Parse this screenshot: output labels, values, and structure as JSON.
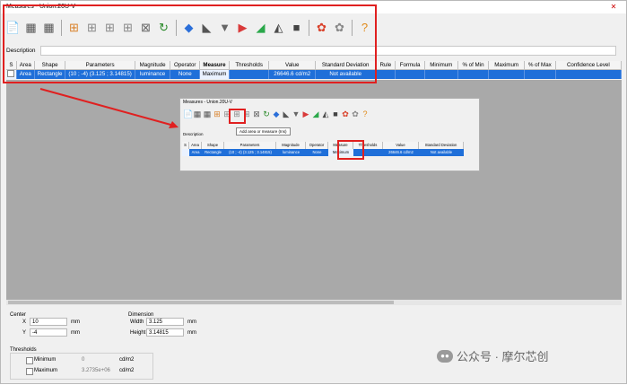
{
  "window": {
    "title": "Measures - Union.20U-V",
    "close_glyph": "✕"
  },
  "toolbar": {
    "icons": [
      {
        "name": "document-icon",
        "glyph": "📄",
        "color": "#c87a1a"
      },
      {
        "name": "grid-icon",
        "glyph": "▦",
        "color": "#555555"
      },
      {
        "name": "grid-arrow-icon",
        "glyph": "▦",
        "color": "#555555"
      },
      {
        "name": "add-area-icon",
        "glyph": "⊞",
        "color": "#d9822b"
      },
      {
        "name": "area-move-icon",
        "glyph": "⊞",
        "color": "#888888"
      },
      {
        "name": "area-move-up-icon",
        "glyph": "⊞",
        "color": "#888888"
      },
      {
        "name": "area-move-down-icon",
        "glyph": "⊞",
        "color": "#888888"
      },
      {
        "name": "area-delete-icon",
        "glyph": "⊠",
        "color": "#666666"
      },
      {
        "name": "refresh-icon",
        "glyph": "↻",
        "color": "#2a8a2a"
      },
      {
        "name": "color-diamond-icon",
        "glyph": "◆",
        "color": "#2b6fd9"
      },
      {
        "name": "ruler-icon",
        "glyph": "◣",
        "color": "#555555"
      },
      {
        "name": "filter-icon",
        "glyph": "▼",
        "color": "#666666"
      },
      {
        "name": "triangle-palette-icon",
        "glyph": "▶",
        "color": "#d93a3a"
      },
      {
        "name": "chart-3d-icon",
        "glyph": "◢",
        "color": "#2aa84a"
      },
      {
        "name": "surface-icon",
        "glyph": "◭",
        "color": "#4a4a4a"
      },
      {
        "name": "square-icon",
        "glyph": "■",
        "color": "#444444"
      },
      {
        "name": "settings-color-icon",
        "glyph": "✿",
        "color": "#d9412a"
      },
      {
        "name": "settings-gray-icon",
        "glyph": "✿",
        "color": "#888888"
      },
      {
        "name": "help-icon",
        "glyph": "?",
        "color": "#e08a1a"
      }
    ]
  },
  "description": {
    "label": "Description",
    "value": ""
  },
  "table": {
    "columns": [
      "S",
      "Area",
      "Shape",
      "Parameters",
      "Magnitude",
      "Operator",
      "Measure",
      "Thresholds",
      "Value",
      "Standard Deviation",
      "Rule",
      "Formula",
      "Minimum",
      "% of Min",
      "Maximum",
      "% of Max",
      "Confidence Level"
    ],
    "rows": [
      {
        "area": "Area",
        "shape": "Rectangle",
        "parameters": "(10 ; -4) (3.125 ; 3.14815)",
        "magnitude": "luminance",
        "operator": "None",
        "measure": "Maximum",
        "thresholds": "",
        "value": "26646.6 cd/m2",
        "std": "Not available",
        "rule": "",
        "formula": "",
        "minimum": "",
        "pct_min": "",
        "maximum": "",
        "pct_max": "",
        "confidence": ""
      }
    ]
  },
  "inset": {
    "title": "Measures - Union.20U-V",
    "tooltip": "Add area or measure (Ins)",
    "description_label": "Description",
    "columns": [
      "S",
      "Area",
      "Shape",
      "Parameters",
      "Magnitude",
      "Operator",
      "Measure",
      "Thresholds",
      "Value",
      "Standard Deviation"
    ],
    "row": {
      "area": "Area",
      "shape": "Rectangle",
      "parameters": "(10 ; -4) (3.125 ; 3.14815)",
      "magnitude": "luminance",
      "operator": "None",
      "measure": "Maximum",
      "thresholds": "",
      "value": "26646.6 cd/m2",
      "std": "Not available"
    }
  },
  "center": {
    "label": "Center",
    "x_label": "X",
    "x_value": "10",
    "x_unit": "mm",
    "y_label": "Y",
    "y_value": "-4",
    "y_unit": "mm"
  },
  "dimension": {
    "label": "Dimension",
    "width_label": "Width",
    "width_value": "3.125",
    "width_unit": "mm",
    "height_label": "Height",
    "height_value": "3.14815",
    "height_unit": "mm"
  },
  "thresholds": {
    "label": "Thresholds",
    "min_label": "Minimum",
    "min_value": "0",
    "min_unit": "cd/m2",
    "max_label": "Maximum",
    "max_value": "3.2735e+06",
    "max_unit": "cd/m2"
  },
  "watermark": {
    "text": "公众号 · 摩尔芯创"
  },
  "colors": {
    "selection": "#1f6fd9",
    "highlight_red": "#e02020",
    "workarea": "#a9a9a9"
  }
}
